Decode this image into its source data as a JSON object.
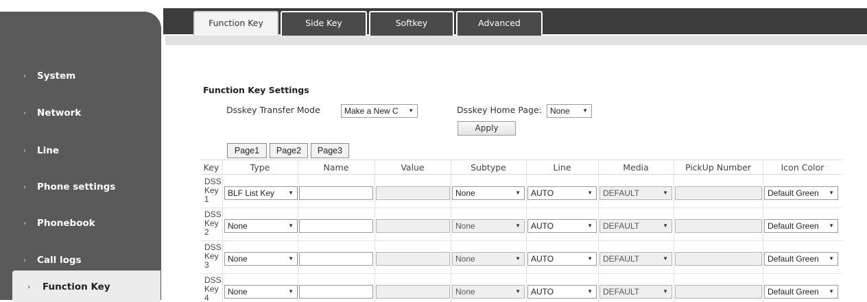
{
  "sidebar": {
    "items": [
      {
        "label": "System"
      },
      {
        "label": "Network"
      },
      {
        "label": "Line"
      },
      {
        "label": "Phone settings"
      },
      {
        "label": "Phonebook"
      },
      {
        "label": "Call logs"
      },
      {
        "label": "Function Key"
      }
    ],
    "active": "Function Key"
  },
  "tabs": [
    {
      "label": "Function Key"
    },
    {
      "label": "Side Key"
    },
    {
      "label": "Softkey"
    },
    {
      "label": "Advanced"
    }
  ],
  "settings": {
    "title": "Function Key Settings",
    "transfer_mode_label": "Dsskey Transfer Mode",
    "transfer_mode_value": "Make a New C",
    "home_page_label": "Dsskey Home Page:",
    "home_page_value": "None",
    "apply_label": "Apply"
  },
  "pages": [
    "Page1",
    "Page2",
    "Page3"
  ],
  "table": {
    "headers": [
      "Key",
      "Type",
      "Name",
      "Value",
      "Subtype",
      "Line",
      "Media",
      "PickUp Number",
      "Icon Color"
    ],
    "rows": [
      {
        "key": [
          "DSS",
          "Key",
          "1"
        ],
        "type": "BLF List Key",
        "name": "",
        "value": "",
        "subtype": "None",
        "line": "AUTO",
        "media": "DEFAULT",
        "pickup": "",
        "icon_color": "Default Green"
      },
      {
        "key": [
          "DSS",
          "Key",
          "2"
        ],
        "type": "None",
        "name": "",
        "value": "",
        "subtype": "None",
        "line": "AUTO",
        "media": "DEFAULT",
        "pickup": "",
        "icon_color": "Default Green"
      },
      {
        "key": [
          "DSS",
          "Key",
          "3"
        ],
        "type": "None",
        "name": "",
        "value": "",
        "subtype": "None",
        "line": "AUTO",
        "media": "DEFAULT",
        "pickup": "",
        "icon_color": "Default Green"
      },
      {
        "key": [
          "DSS",
          "Key",
          "4"
        ],
        "type": "None",
        "name": "",
        "value": "",
        "subtype": "None",
        "line": "AUTO",
        "media": "DEFAULT",
        "pickup": "",
        "icon_color": "Default Green"
      }
    ]
  },
  "icons": {
    "sidebar_chevron": "chevron-right-icon",
    "select_arrow": "caret-down-icon"
  }
}
